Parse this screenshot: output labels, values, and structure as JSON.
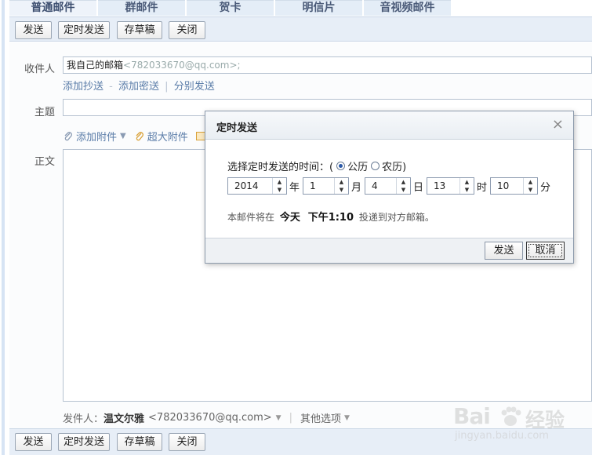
{
  "tabs": [
    "普通邮件",
    "群邮件",
    "贺卡",
    "明信片",
    "音视频邮件"
  ],
  "toolbar": {
    "send": "发送",
    "scheduled_send": "定时发送",
    "save_draft": "存草稿",
    "close": "关闭"
  },
  "compose": {
    "to_label": "收件人",
    "to_name": "我自己的邮箱",
    "to_addr": "<782033670@qq.com>;",
    "add_cc": "添加抄送",
    "add_bcc": "添加密送",
    "link_sep": "-",
    "separate_send": "分别发送",
    "subject_label": "主题",
    "add_attachment": "添加附件",
    "large_attachment": "超大附件",
    "body_label": "正文",
    "sender_label": "发件人：",
    "sender_name": "温文尔雅",
    "sender_addr": "<782033670@qq.com>",
    "more_options": "其他选项"
  },
  "dialog": {
    "title": "定时发送",
    "close_glyph": "×",
    "prompt": "选择定时发送的时间：(",
    "solar": "公历",
    "lunar": "农历)",
    "year": "2014",
    "year_unit": "年",
    "month": "1",
    "month_unit": "月",
    "day": "4",
    "day_unit": "日",
    "hour": "13",
    "hour_unit": "时",
    "minute": "10",
    "minute_unit": "分",
    "info_prefix": "本邮件将在",
    "info_day": "今天",
    "info_time": "下午1:10",
    "info_suffix": "投递到对方邮箱。",
    "send": "发送",
    "cancel": "取消"
  },
  "watermark": {
    "brand_left": "Bai",
    "brand_right": "经验",
    "url": "jingyan.baidu.com"
  },
  "colors": {
    "toolbar_bg": "#e7eef7",
    "tab_bg": "#e4edf7",
    "link": "#5a7ca8",
    "radio_selected": "#2b59a8"
  }
}
